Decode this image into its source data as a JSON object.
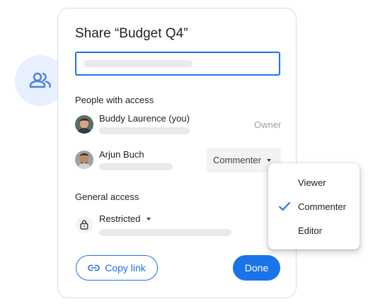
{
  "dialog": {
    "title": "Share “Budget Q4”",
    "search_input": {
      "value": "",
      "placeholder": ""
    }
  },
  "people_with_access": {
    "heading": "People with access",
    "people": [
      {
        "name": "Buddy Laurence (you)",
        "role": "Owner"
      },
      {
        "name": "Arjun Buch",
        "role": "Commenter"
      }
    ]
  },
  "general_access": {
    "heading": "General access",
    "selected": "Restricted"
  },
  "buttons": {
    "copy_link": "Copy link",
    "done": "Done"
  },
  "role_menu": {
    "items": [
      {
        "label": "Viewer",
        "checked": false
      },
      {
        "label": "Commenter",
        "checked": true
      },
      {
        "label": "Editor",
        "checked": false
      }
    ]
  },
  "icons": {
    "people": "people-icon",
    "lock": "lock-icon",
    "link": "link-icon",
    "check": "check-icon",
    "caret": "caret-down-icon"
  },
  "colors": {
    "accent": "#1a73e8",
    "bubble": "#e8f0fe",
    "muted_text": "#9aa0a6",
    "chip_bg": "#f1f3f4"
  }
}
